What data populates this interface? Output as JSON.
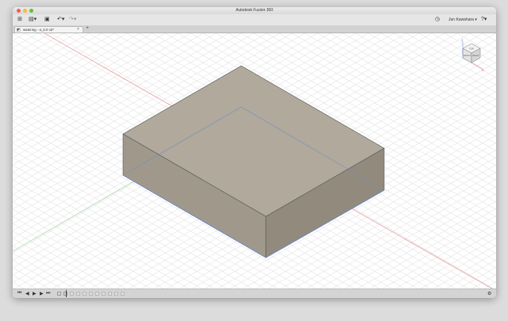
{
  "app": {
    "title": "Autodesk Fusion 360",
    "user_name": "Jun Kawahara ▾"
  },
  "toolbar": {
    "grid_icon": "⊞",
    "file_icon": "▤▾",
    "save_icon": "▣",
    "undo_icon": "↶▾",
    "redo_icon": "↷▾",
    "clock_icon": "◷",
    "help_icon": "?▾"
  },
  "document_tab": {
    "label": "watering - a_6.0 v2*",
    "close": "×",
    "new_tab": "+"
  },
  "viewcube": {
    "face_top": "TOP",
    "face_front": "FRONT",
    "face_right": "RIGHT",
    "axis_z": "Z",
    "axis_x": "X"
  },
  "timeline": {
    "buttons": [
      "⏮",
      "◀",
      "▶",
      "▶",
      "⏭"
    ],
    "settings_icon": "⚙"
  },
  "colors": {
    "model_top": "#b0a99c",
    "model_front": "#a0998b",
    "model_right": "#928b7d",
    "grid_line": "#e3e3e3",
    "axis_red": "#e48f8f",
    "axis_green": "#9ed09e",
    "edge_blue": "#6a88cc"
  }
}
